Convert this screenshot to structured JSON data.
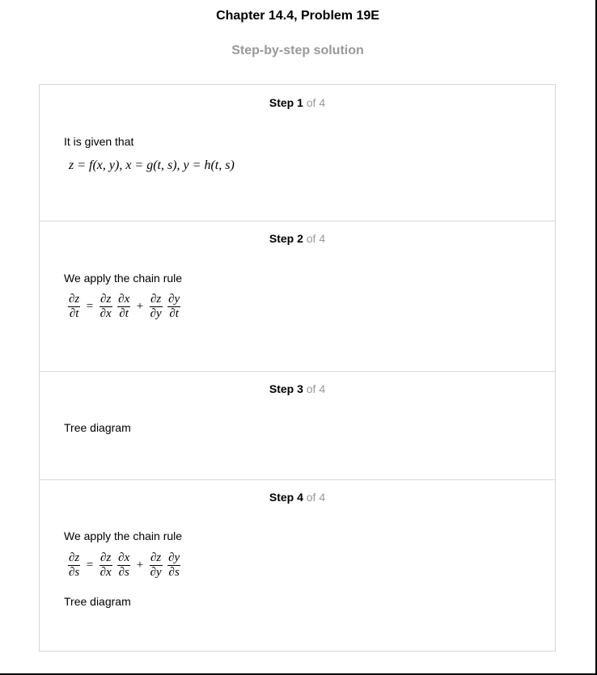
{
  "header": {
    "title": "Chapter 14.4, Problem 19E",
    "subtitle": "Step-by-step solution"
  },
  "steps": [
    {
      "label": "Step 1",
      "of": "of 4",
      "text": "It is given that",
      "formula": "z = f(x, y),  x = g(t, s),  y = h(t, s)"
    },
    {
      "label": "Step 2",
      "of": "of 4",
      "text": "We apply the chain rule",
      "chain": {
        "lhs_num": "∂z",
        "lhs_den": "∂t",
        "t1a_num": "∂z",
        "t1a_den": "∂x",
        "t1b_num": "∂x",
        "t1b_den": "∂t",
        "t2a_num": "∂z",
        "t2a_den": "∂y",
        "t2b_num": "∂y",
        "t2b_den": "∂t",
        "eq": "=",
        "plus": "+"
      }
    },
    {
      "label": "Step 3",
      "of": "of 4",
      "text": "Tree diagram"
    },
    {
      "label": "Step 4",
      "of": "of 4",
      "text": "We apply the chain rule",
      "chain": {
        "lhs_num": "∂z",
        "lhs_den": "∂s",
        "t1a_num": "∂z",
        "t1a_den": "∂x",
        "t1b_num": "∂x",
        "t1b_den": "∂s",
        "t2a_num": "∂z",
        "t2a_den": "∂y",
        "t2b_num": "∂y",
        "t2b_den": "∂s",
        "eq": "=",
        "plus": "+"
      },
      "text2": "Tree diagram"
    }
  ]
}
